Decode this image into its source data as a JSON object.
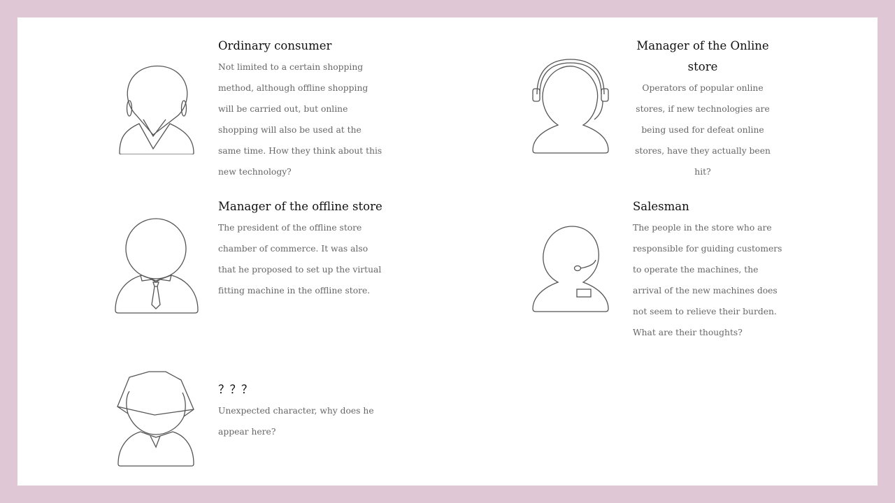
{
  "personas": [
    {
      "title": "Ordinary consumer",
      "description": "Not limited to a certain shopping method, although offline shopping will be carried out, but online shopping will also be used at the same time. How they think about this new technology?",
      "icon": "female-consumer-icon"
    },
    {
      "title": "Manager of the Online store",
      "description": "Operators of popular online stores, if new technologies are being used for defeat online stores, have they actually been hit?",
      "icon": "headset-operator-icon"
    },
    {
      "title": "Manager of the offline store",
      "description": "The president of the offline store chamber of commerce. It was also that he proposed to set up the virtual fitting machine in the offline store.",
      "icon": "businessman-tie-icon"
    },
    {
      "title": "Salesman",
      "description": "The people in the store who are responsible for guiding customers to operate the machines, the arrival of the new machines does not seem to relieve their burden. What are their thoughts?",
      "icon": "salesman-badge-icon"
    },
    {
      "title": "？？？",
      "description": "Unexpected character, why does he appear here?",
      "icon": "hooded-mystery-icon"
    }
  ],
  "colors": {
    "background": "#dfc7d6",
    "slide": "#ffffff",
    "title": "#111111",
    "description": "#666666",
    "icon_stroke": "#555555"
  }
}
